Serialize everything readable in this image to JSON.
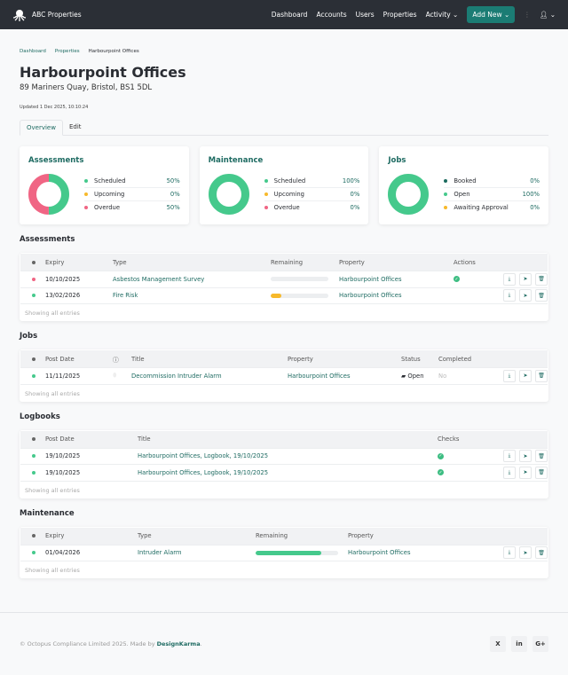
{
  "nav": {
    "brand": "ABC Properties",
    "links": [
      "Dashboard",
      "Accounts",
      "Users",
      "Properties",
      "Activity"
    ],
    "add_new": "Add New"
  },
  "breadcrumb": [
    "Dashboard",
    "Properties",
    "Harbourpoint Offices"
  ],
  "title": "Harbourpoint Offices",
  "address": "89 Mariners Quay, Bristol, BS1 5DL",
  "updated": "Updated 1 Dec 2025, 10:10:24",
  "tabs": [
    "Overview",
    "Edit"
  ],
  "colors": {
    "green": "#45c98c",
    "amber": "#f7b92b",
    "red": "#f06584",
    "teal": "#1e6b62",
    "grey": "#e9ecef"
  },
  "cards": [
    {
      "title": "Assessments",
      "items": [
        {
          "label": "Scheduled",
          "value": "50%",
          "pct": 50,
          "color": "#45c98c"
        },
        {
          "label": "Upcoming",
          "value": "0%",
          "pct": 0,
          "color": "#f7b92b"
        },
        {
          "label": "Overdue",
          "value": "50%",
          "pct": 50,
          "color": "#f06584"
        }
      ]
    },
    {
      "title": "Maintenance",
      "items": [
        {
          "label": "Scheduled",
          "value": "100%",
          "pct": 100,
          "color": "#45c98c"
        },
        {
          "label": "Upcoming",
          "value": "0%",
          "pct": 0,
          "color": "#f7b92b"
        },
        {
          "label": "Overdue",
          "value": "0%",
          "pct": 0,
          "color": "#f06584"
        }
      ]
    },
    {
      "title": "Jobs",
      "items": [
        {
          "label": "Booked",
          "value": "0%",
          "pct": 0,
          "color": "#1b6b5f"
        },
        {
          "label": "Open",
          "value": "100%",
          "pct": 100,
          "color": "#45c98c"
        },
        {
          "label": "Awaiting Approval",
          "value": "0%",
          "pct": 0,
          "color": "#f7b92b"
        }
      ]
    }
  ],
  "footer_text": "Showing all entries",
  "assessments": {
    "heading": "Assessments",
    "cols": [
      "Expiry",
      "Type",
      "Remaining",
      "Property",
      "Actions"
    ],
    "rows": [
      {
        "expiry": "10/10/2025",
        "type": "Asbestos Management Survey",
        "remaining": 0,
        "property": "Harbourpoint Offices",
        "status": "#f06584",
        "done": true
      },
      {
        "expiry": "13/02/2026",
        "type": "Fire Risk",
        "remaining": 18,
        "property": "Harbourpoint Offices",
        "status": "#45c98c",
        "done": false
      }
    ]
  },
  "jobs": {
    "heading": "Jobs",
    "cols": [
      "Post Date",
      "Title",
      "Property",
      "Status",
      "Completed"
    ],
    "rows": [
      {
        "date": "11/11/2025",
        "title": "Decommission Intruder Alarm",
        "property": "Harbourpoint Offices",
        "status": "Open",
        "completed": "No"
      }
    ]
  },
  "logbooks": {
    "heading": "Logbooks",
    "cols": [
      "Post Date",
      "Title",
      "Checks"
    ],
    "rows": [
      {
        "date": "19/10/2025",
        "title": "Harbourpoint Offices, Logbook, 19/10/2025"
      },
      {
        "date": "19/10/2025",
        "title": "Harbourpoint Offices, Logbook, 19/10/2025"
      }
    ]
  },
  "maintenance": {
    "heading": "Maintenance",
    "cols": [
      "Expiry",
      "Type",
      "Remaining",
      "Property"
    ],
    "rows": [
      {
        "expiry": "01/04/2026",
        "type": "Intruder Alarm",
        "remaining": 80,
        "property": "Harbourpoint Offices"
      }
    ]
  },
  "footer": {
    "copyright": "© Octopus Compliance Limited 2025. Made by ",
    "brand": "DesignKarma",
    "social": [
      "X",
      "in",
      "G+"
    ]
  }
}
